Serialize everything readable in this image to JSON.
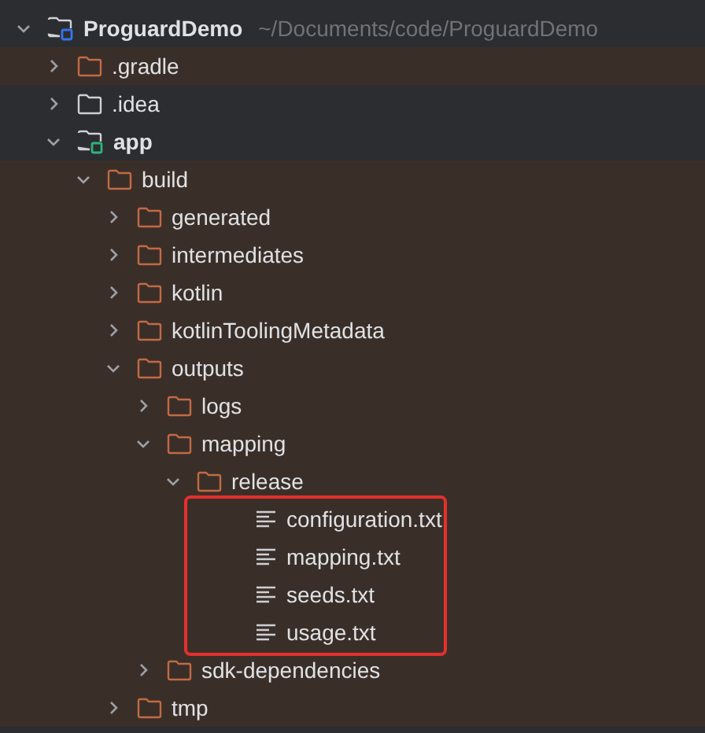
{
  "tree": [
    {
      "name": "ProguardDemo",
      "path": "~/Documents/code/ProguardDemo",
      "kind": "module",
      "color": "#3574f0",
      "expanded": true,
      "excluded": false,
      "children": [
        {
          "name": ".gradle",
          "kind": "folder",
          "expanded": false,
          "excluded": true
        },
        {
          "name": ".idea",
          "kind": "folder",
          "expanded": false,
          "excluded": false
        },
        {
          "name": "app",
          "kind": "module",
          "color": "#2fb37a",
          "expanded": true,
          "excluded": false,
          "children": [
            {
              "name": "build",
              "kind": "folder",
              "expanded": true,
              "excluded": true,
              "children": [
                {
                  "name": "generated",
                  "kind": "folder",
                  "expanded": false,
                  "excluded": true
                },
                {
                  "name": "intermediates",
                  "kind": "folder",
                  "expanded": false,
                  "excluded": true
                },
                {
                  "name": "kotlin",
                  "kind": "folder",
                  "expanded": false,
                  "excluded": true
                },
                {
                  "name": "kotlinToolingMetadata",
                  "kind": "folder",
                  "expanded": false,
                  "excluded": true
                },
                {
                  "name": "outputs",
                  "kind": "folder",
                  "expanded": true,
                  "excluded": true,
                  "children": [
                    {
                      "name": "logs",
                      "kind": "folder",
                      "expanded": false,
                      "excluded": true
                    },
                    {
                      "name": "mapping",
                      "kind": "folder",
                      "expanded": true,
                      "excluded": true,
                      "children": [
                        {
                          "name": "release",
                          "kind": "folder",
                          "expanded": true,
                          "excluded": true,
                          "children": [
                            {
                              "name": "configuration.txt",
                              "kind": "file",
                              "excluded": true,
                              "highlighted": true
                            },
                            {
                              "name": "mapping.txt",
                              "kind": "file",
                              "excluded": true,
                              "highlighted": true
                            },
                            {
                              "name": "seeds.txt",
                              "kind": "file",
                              "excluded": true,
                              "highlighted": true
                            },
                            {
                              "name": "usage.txt",
                              "kind": "file",
                              "excluded": true,
                              "highlighted": true
                            }
                          ]
                        }
                      ]
                    },
                    {
                      "name": "sdk-dependencies",
                      "kind": "folder",
                      "expanded": false,
                      "excluded": true
                    }
                  ]
                },
                {
                  "name": "tmp",
                  "kind": "folder",
                  "expanded": false,
                  "excluded": true
                }
              ]
            }
          ]
        }
      ]
    }
  ]
}
